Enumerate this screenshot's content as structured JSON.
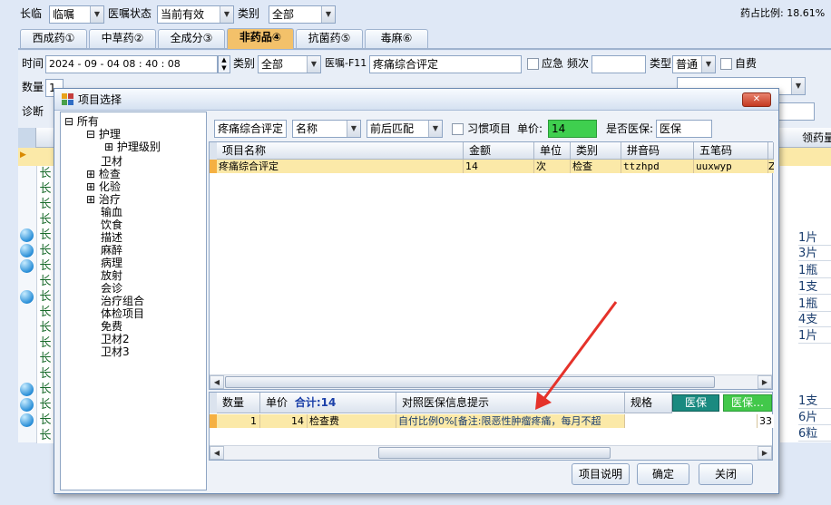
{
  "top": {
    "label_changlin": "长临",
    "order_type": "临嘱",
    "label_status": "医嘱状态",
    "status": "当前有效",
    "label_category": "类别",
    "category": "全部",
    "drug_ratio": "药占比例: 18.61%"
  },
  "tabs": [
    "西成药①",
    "中草药②",
    "全成分③",
    "非药品④",
    "抗菌药⑤",
    "毒麻⑥"
  ],
  "form": {
    "label_time": "时间",
    "time_value": "2024 - 09 - 04   08 : 40 : 08",
    "label_category": "类别",
    "category": "全部",
    "order_label": "医嘱-F11",
    "order_value": "疼痛综合评定",
    "emergency_label": "应急",
    "freq_label": "频次",
    "type_label": "类型",
    "type_value": "普通",
    "self_pay_label": "自费",
    "label_qty": "数量",
    "qty_value": "1",
    "label_diag": "诊断",
    "right_header": "领药量"
  },
  "background_right": [
    "1片",
    "3片",
    "1瓶",
    "1支",
    "1瓶",
    "4支",
    "1片",
    "1支",
    "6片",
    "6粒"
  ],
  "background_left_tag": "长",
  "dialog": {
    "title": "项目选择",
    "close_label": "✕",
    "tree": {
      "root": "所有",
      "nursing": "护理",
      "nursing_level": "护理级别",
      "items": [
        "卫材",
        "检查",
        "化验",
        "治疗",
        "输血",
        "饮食",
        "描述",
        "麻醉",
        "病理",
        "放射",
        "会诊",
        "治疗组合",
        "体检项目",
        "免费",
        "卫材2",
        "卫材3"
      ]
    },
    "toolbar": {
      "search_value": "疼痛综合评定",
      "field": "名称",
      "match": "前后匹配",
      "habit_label": "习惯项目",
      "price_label": "单价:",
      "price_value": "14",
      "insurance_label": "是否医保:",
      "insurance_value": "医保"
    },
    "top_grid": {
      "headers": [
        "项目名称",
        "金额",
        "单位",
        "类别",
        "拼音码",
        "五笔码"
      ],
      "row": [
        "疼痛综合评定",
        "14",
        "次",
        "检查",
        "ttzhpd",
        "uuxwyp",
        "Z"
      ]
    },
    "bottom_grid": {
      "headers": [
        "数量",
        "单价",
        "合计:14",
        "对照医保信息提示",
        "规格",
        "医保",
        "医保…"
      ],
      "total_label": "合计:14",
      "row": [
        "1",
        "14",
        "检查费",
        "自付比例0%[备注:限恶性肿瘤疼痛，每月不超",
        "",
        "33"
      ]
    },
    "buttons": {
      "explain": "项目说明",
      "confirm": "确定",
      "close": "关闭"
    }
  },
  "colors": {
    "selected_row": "#fbe9a8",
    "tab_active": "#f3c16a",
    "insurance_green": "#1a8a80",
    "price_green": "#3fcf4f"
  }
}
